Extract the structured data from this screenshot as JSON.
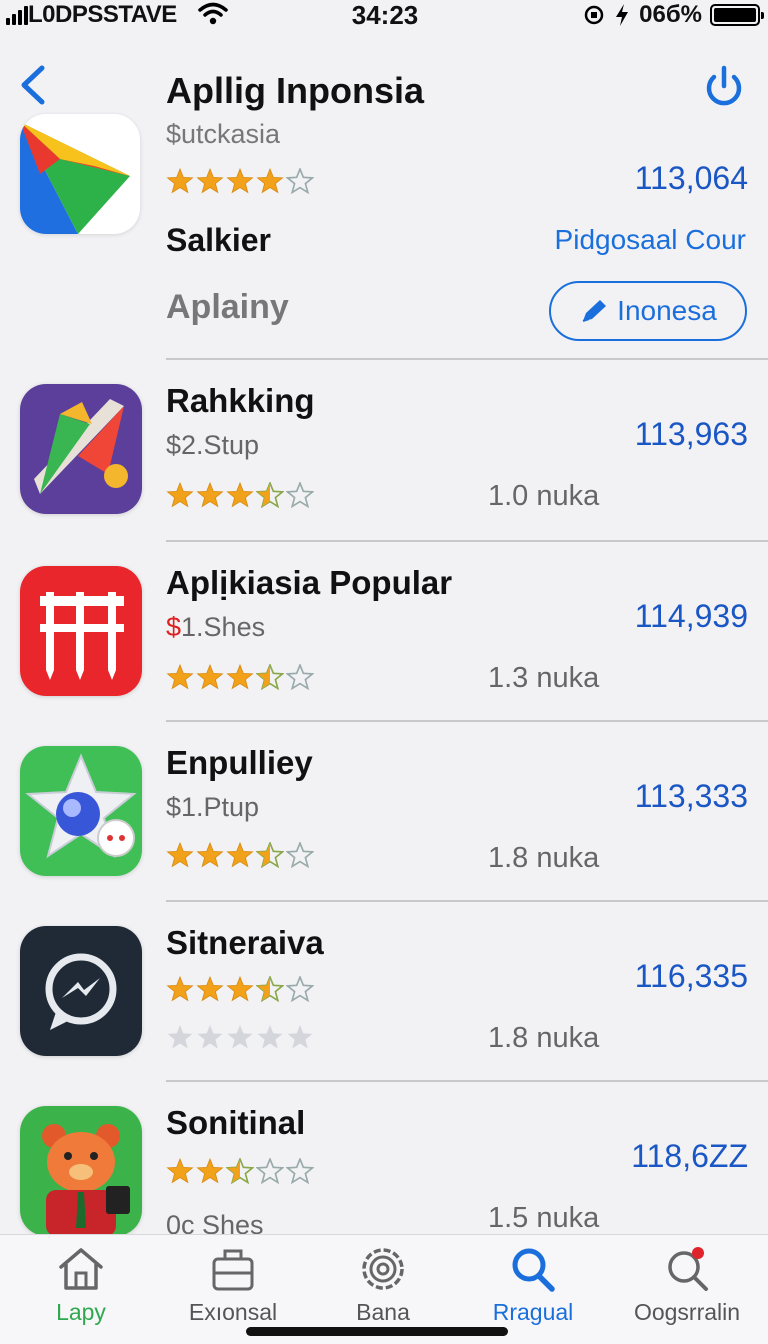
{
  "status_bar": {
    "carrier": "L0DPSSTAVE",
    "time": "34:23",
    "battery_text": "06б%"
  },
  "header": {
    "title": "Apllig Inponsia"
  },
  "featured": {
    "subtitle": "$utckasia",
    "rating": 4,
    "count": "113,064",
    "name": "Salkier",
    "link": "Pidgosaal Cour",
    "category": "Aplainy",
    "button_label": "Inonesa"
  },
  "apps": [
    {
      "name": "Rahkking",
      "price": "$2.Stup",
      "count": "113,963",
      "size": "1.0 nuka",
      "rating": 3.5
    },
    {
      "name": "Aplịkiasia Popular",
      "price_symbol": "$",
      "price": "1.Shes",
      "count": "114,939",
      "size": "1.3 nuka",
      "rating": 3.5
    },
    {
      "name": "Enpulliey",
      "price": "$1.Ptup",
      "count": "113,333",
      "size": "1.8 nuka",
      "rating": 3.5
    },
    {
      "name": "Sitneraiva",
      "price": "",
      "count": "116,335",
      "size": "1.8 nuka",
      "rating": 3.5
    },
    {
      "name": "Sonitinal",
      "price": "0c Shes",
      "count": "118,6ZZ",
      "size": "1.5 nuka",
      "rating": 2.5
    }
  ],
  "tabs": [
    {
      "label": "Lapy",
      "icon": "home-icon",
      "color": "#2fa84f"
    },
    {
      "label": "Exıonsal",
      "icon": "briefcase-icon",
      "color": "#555555"
    },
    {
      "label": "Bana",
      "icon": "gear-icon",
      "color": "#555555"
    },
    {
      "label": "Rragual",
      "icon": "search-icon",
      "color": "#1a6fdc"
    },
    {
      "label": "Oogsrralin",
      "icon": "search-alert-icon",
      "color": "#555555"
    }
  ],
  "colors": {
    "accent": "#1a6fdc",
    "star": "#f2a11b"
  }
}
